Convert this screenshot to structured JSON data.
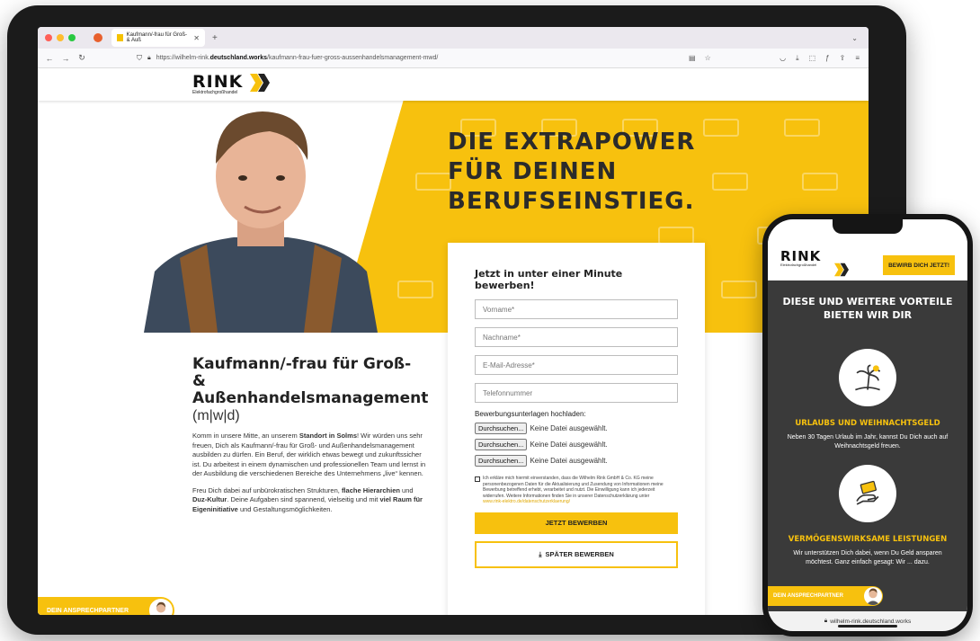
{
  "browser": {
    "tab_title": "Kaufmann/-frau für Groß- & Auß",
    "url_prefix": "https://wilhelm-rink.",
    "url_domain": "deutschland.works",
    "url_path": "/kaufmann-frau-fuer-gross-aussenhandelsmanagement-mwd/",
    "tab_close": "✕",
    "new_tab": "+"
  },
  "site": {
    "logo_text": "RINK",
    "logo_sub": "Elektrofachgroßhandel",
    "hero_title_lines": [
      "DIE EXTRAPOWER",
      "FÜR DEINEN",
      "BERUFSEINSTIEG."
    ],
    "job_title": "Kaufmann/-frau für Groß- & Außenhandelsmanagement",
    "job_sub": "(m|w|d)",
    "para1_a": "Komm in unsere Mitte, an unserem ",
    "para1_b": "Standort in Solms",
    "para1_c": "! Wir würden uns sehr freuen, Dich als Kaufmann/-frau für Groß- und Außenhandelsmanagement ausbilden zu dürfen. Ein Beruf, der wirklich etwas bewegt und zukunftssicher ist. Du arbeitest in einem dynamischen und professionellen Team und lernst in der Ausbildung die verschiedenen Bereiche des Unternehmens „live“ kennen.",
    "para2_a": "Freu Dich dabei auf unbürokratischen Strukturen, ",
    "para2_b": "flache Hierarchien",
    "para2_c": " und ",
    "para2_d": "Duz-Kultur",
    "para2_e": ". Deine Aufgaben sind spannend, vielseitig und mit ",
    "para2_f": "viel Raum für Eigeninitiative",
    "para2_g": " und Gestaltungsmöglichkeiten.",
    "contact_label": "DEIN ANSPRECHPARTNER"
  },
  "form": {
    "heading": "Jetzt in unter einer Minute bewerben!",
    "fields": [
      "Vorname*",
      "Nachname*",
      "E-Mail-Adresse*",
      "Telefonnummer"
    ],
    "upload_label": "Bewerbungsunterlagen hochladen:",
    "upload_button": "Durchsuchen...",
    "upload_status": "Keine Datei ausgewählt.",
    "consent_text": "Ich erkläre mich hiermit einverstanden, dass die Wilhelm Rink GmbH & Co. KG meine personenbezogenen Daten für die Aktualisierung und Zusendung von Informationen meine Bewerbung betreffend erhebt, verarbeitet und nutzt. Die Einwilligung kann ich jederzeit widerrufen. Weitere Informationen finden Sie in unserer Datenschutzerklärung unter",
    "consent_link": "www.rink-elektro.de/datenschutzerklaerung/",
    "submit_label": "JETZT BEWERBEN",
    "later_label": "SPÄTER BEWERBEN"
  },
  "phone": {
    "apply_label": "BEWIRB DICH JETZT!",
    "section_title_1": "DIESE UND WEITERE VORTEILE",
    "section_title_2": "BIETEN WIR DIR",
    "benefit1_title": "URLAUBS UND WEIHNACHTSGELD",
    "benefit1_text": "Neben 30 Tagen Urlaub im Jahr, kannst Du Dich auch auf Weihnachtsgeld freuen.",
    "benefit2_title": "VERMÖGENSWIRKSAME LEISTUNGEN",
    "benefit2_text": "Wir unterstützen Dich dabei, wenn Du Geld ansparen möchtest. Ganz einfach gesagt: Wir ... dazu.",
    "contact_label": "DEIN ANSPRECHPARTNER",
    "url": "wilhelm-rink.deutschland.works"
  },
  "colors": {
    "brand_yellow": "#f7c10e",
    "dark_panel": "#3a3a3a"
  }
}
